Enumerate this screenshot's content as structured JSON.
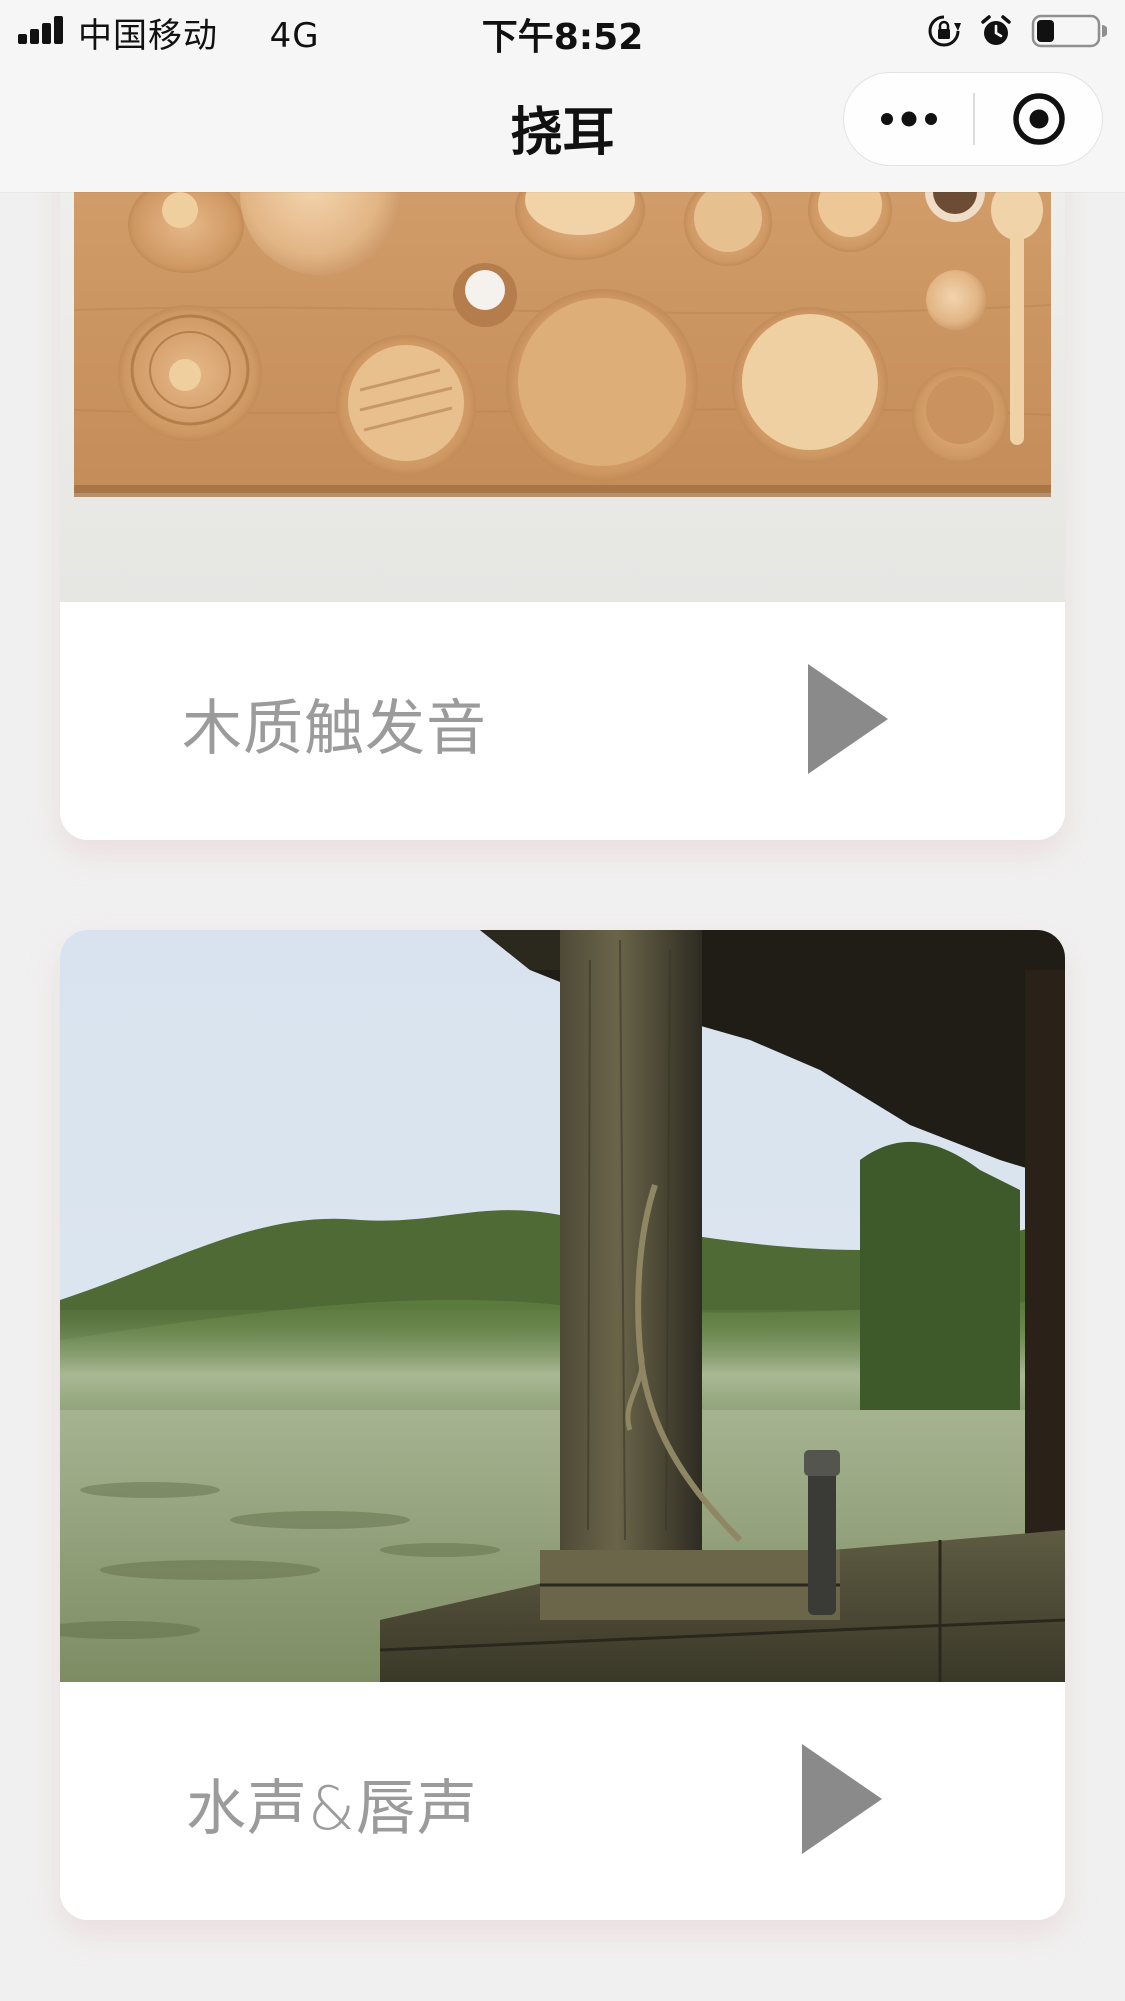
{
  "status_bar": {
    "carrier": "中国移动",
    "network": "4G",
    "time": "下午8:52",
    "battery_level": 0.3
  },
  "navbar": {
    "title": "挠耳",
    "more_icon": "ellipsis-icon",
    "close_icon": "target-close-icon"
  },
  "sounds": [
    {
      "label": "木质触发音",
      "image": "wooden-bowls-photo",
      "play_icon": "play-icon"
    },
    {
      "label": "水声&唇声",
      "image": "misty-lake-dock-photo",
      "play_icon": "play-icon"
    }
  ],
  "colors": {
    "background": "#f1f0f0",
    "label_text": "#9b9b9b",
    "play_icon": "#8a8a8a",
    "card": "#ffffff"
  }
}
